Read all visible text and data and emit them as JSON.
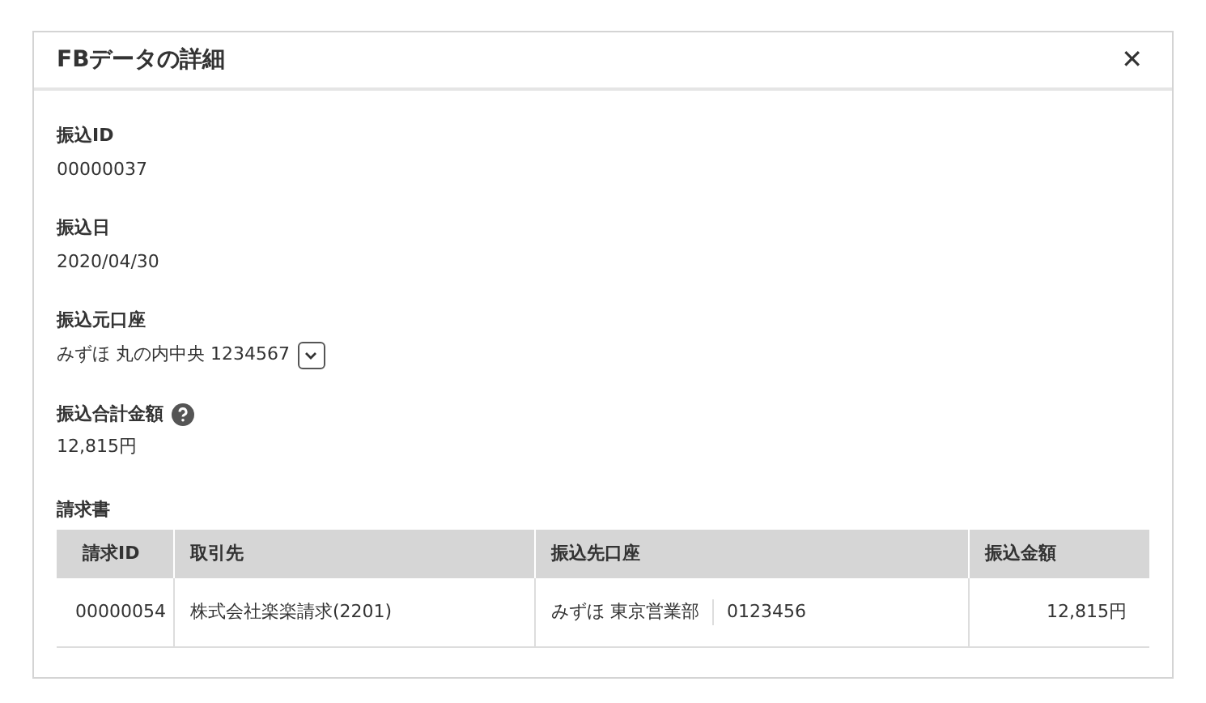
{
  "dialog": {
    "title": "FBデータの詳細",
    "close": "✕"
  },
  "fields": [
    {
      "kind": "plain",
      "label": "振込ID",
      "value": "00000037"
    },
    {
      "kind": "plain",
      "label": "振込日",
      "value": "2020/04/30"
    },
    {
      "kind": "dropdown",
      "label": "振込元口座",
      "value": "みずほ 丸の内中央 1234567"
    },
    {
      "kind": "help",
      "label": "振込合計金額",
      "value": "12,815円"
    }
  ],
  "invoices": {
    "label": "請求書",
    "columns": [
      "請求ID",
      "取引先",
      "振込先口座",
      "振込金額"
    ],
    "rows": [
      {
        "id": "00000054",
        "partner": "株式会社楽楽請求(2201)",
        "bank": "みずほ 東京営業部",
        "account": "0123456",
        "amount": "12,815円"
      }
    ]
  }
}
